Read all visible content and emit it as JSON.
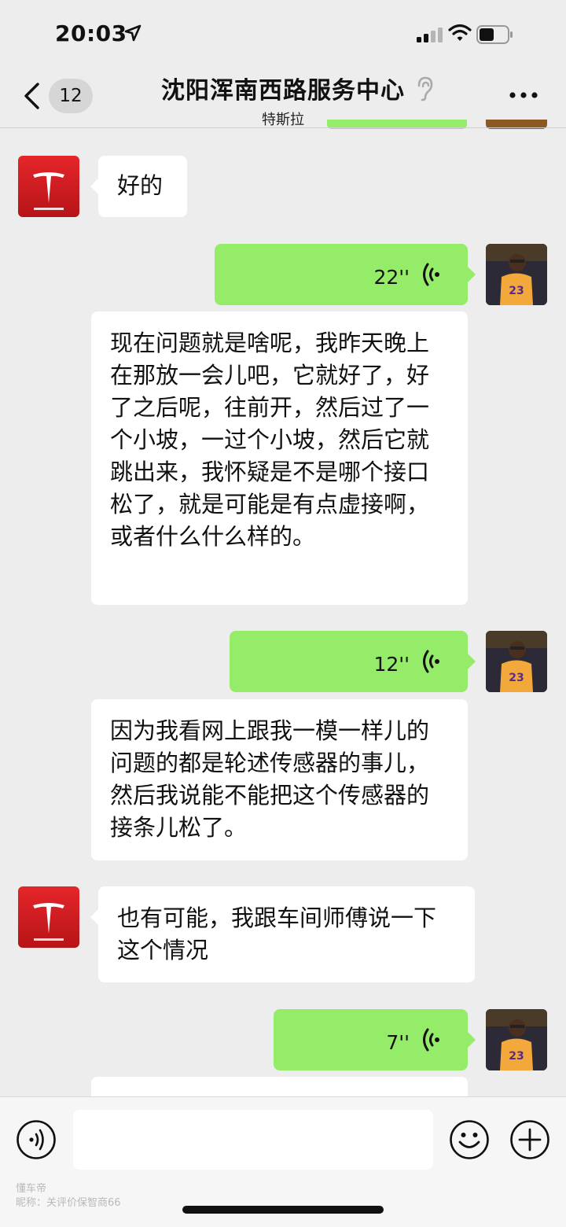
{
  "status_bar": {
    "time": "20:03"
  },
  "header": {
    "back_count": "12",
    "title": "沈阳浑南西路服务中心",
    "subtitle": "特斯拉"
  },
  "messages": [
    {
      "sender": "tesla",
      "type": "text",
      "text": "好的"
    },
    {
      "sender": "me",
      "type": "voice",
      "duration": "22''"
    },
    {
      "sender": "me",
      "type": "voice_transcript",
      "text": "现在问题就是啥呢，我昨天晚上在那放一会儿吧，它就好了，好了之后呢，往前开，然后过了一个小坡，一过个小坡，然后它就跳出来，我怀疑是不是哪个接口松了，就是可能是有点虚接啊，或者什么什么样的。"
    },
    {
      "sender": "me",
      "type": "voice",
      "duration": "12''"
    },
    {
      "sender": "me",
      "type": "voice_transcript",
      "text": "因为我看网上跟我一模一样儿的问题的都是轮述传感器的事儿，然后我说能不能把这个传感器的接条儿松了。"
    },
    {
      "sender": "tesla",
      "type": "text",
      "text": "也有可能，我跟车间师傅说一下这个情况"
    },
    {
      "sender": "me",
      "type": "voice",
      "duration": "7''"
    }
  ],
  "input": {
    "placeholder": ""
  },
  "watermark": {
    "line1": "懂车帝",
    "line2": "昵称：关评价保智商66"
  },
  "colors": {
    "background": "#ededed",
    "my_bubble": "#95ec69",
    "their_bubble": "#ffffff",
    "tesla_red": "#e31937"
  },
  "icons": {
    "location": "location-arrow-icon",
    "signal": "cellular-signal-icon",
    "wifi": "wifi-icon",
    "battery": "battery-icon",
    "back": "chevron-left-icon",
    "ear": "ear-icon",
    "more": "more-dots-icon",
    "voice_wave": "voice-wave-icon",
    "voice_toggle": "voice-input-icon",
    "emoji": "emoji-icon",
    "plus": "plus-icon"
  }
}
